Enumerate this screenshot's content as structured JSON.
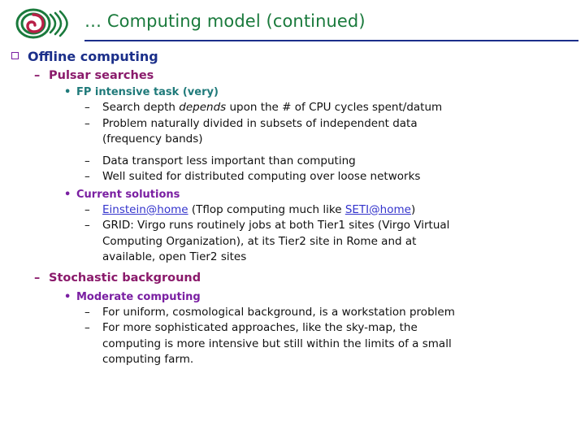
{
  "header": {
    "title": "… Computing model (continued)",
    "logo_name": "virgo-spiral-logo"
  },
  "colors": {
    "title": "#1a7a3c",
    "rule": "#1b2f8a",
    "level1": "#1b2f8a",
    "level2": "#8a1a6b",
    "level3_teal": "#1f7a7a",
    "level3_purple": "#7a1fa2",
    "body": "#101010",
    "link": "#3333cc",
    "bullet_square": "#7a1fa2"
  },
  "outline": {
    "section1": {
      "label": "Offline computing",
      "bullet": "q",
      "sub1": {
        "label": "Pulsar searches",
        "dash": "–",
        "groups": [
          {
            "label": "FP intensive task (very)",
            "marker": "•",
            "color": "teal",
            "items": [
              {
                "marker": "–",
                "parts": [
                  {
                    "text": "Search depth ",
                    "style": "plain"
                  },
                  {
                    "text": "depends",
                    "style": "italic"
                  },
                  {
                    "text": " upon the # of CPU cycles spent/datum",
                    "style": "plain"
                  }
                ]
              },
              {
                "marker": "–",
                "parts": [
                  {
                    "text": "Problem naturally divided in subsets of independent data",
                    "style": "plain"
                  }
                ],
                "continuation": "(frequency bands)"
              },
              {
                "marker": "–",
                "parts": [
                  {
                    "text": "Data transport less important than computing",
                    "style": "plain"
                  }
                ],
                "spaced": true
              },
              {
                "marker": "–",
                "parts": [
                  {
                    "text": "Well suited for distributed computing over loose networks",
                    "style": "plain"
                  }
                ]
              }
            ]
          },
          {
            "label": "Current solutions",
            "marker": "•",
            "color": "purple",
            "items": [
              {
                "marker": "–",
                "parts": [
                  {
                    "text": "Einstein@home",
                    "style": "link"
                  },
                  {
                    "text": " (Tflop computing much like ",
                    "style": "plain"
                  },
                  {
                    "text": "SETI@home",
                    "style": "link"
                  },
                  {
                    "text": ")",
                    "style": "plain"
                  }
                ]
              },
              {
                "marker": "–",
                "parts": [
                  {
                    "text": "GRID: Virgo runs routinely jobs at both Tier1 sites (Virgo Virtual",
                    "style": "plain"
                  }
                ],
                "continuation": "Computing Organization), at its Tier2 site in Rome and at",
                "continuation2": "available, open Tier2 sites"
              }
            ]
          }
        ]
      },
      "sub2": {
        "label": "Stochastic background",
        "dash": "–",
        "groups": [
          {
            "label": "Moderate computing",
            "marker": "•",
            "color": "purple",
            "items": [
              {
                "marker": "–",
                "parts": [
                  {
                    "text": "For uniform, cosmological background, is a workstation problem",
                    "style": "plain"
                  }
                ]
              },
              {
                "marker": "–",
                "parts": [
                  {
                    "text": "For more sophisticated approaches, like the sky-map, the",
                    "style": "plain"
                  }
                ],
                "continuation": "computing is more intensive but still within the limits of a small",
                "continuation2": "computing farm."
              }
            ]
          }
        ]
      }
    }
  }
}
